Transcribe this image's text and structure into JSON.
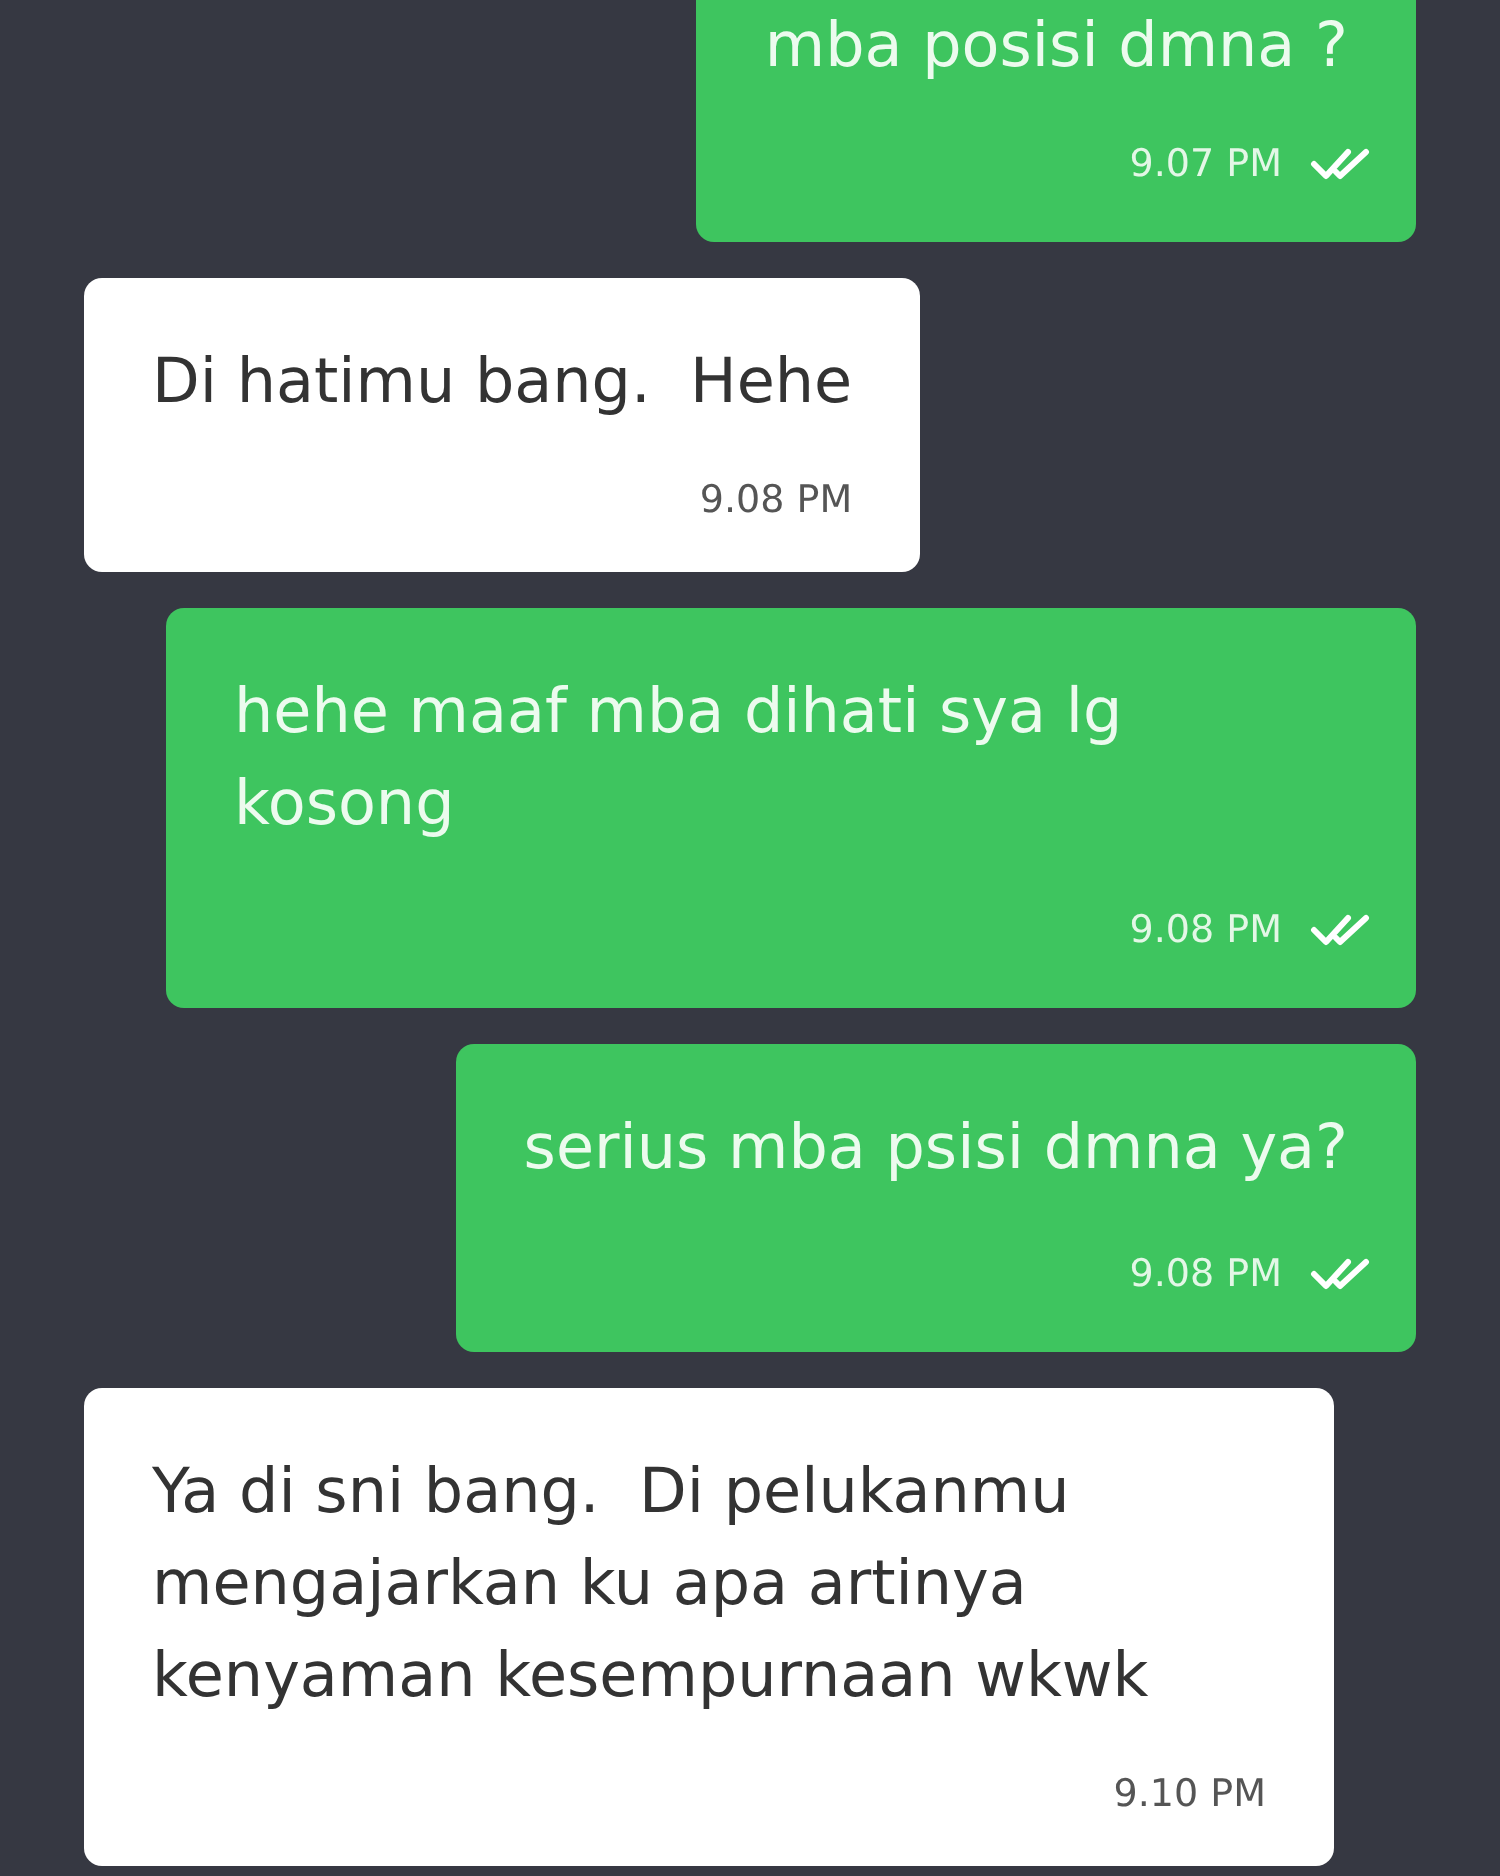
{
  "messages": [
    {
      "kind": "outgoing",
      "text": "mba posisi dmna ?",
      "time": "9.07 PM",
      "read": true
    },
    {
      "kind": "incoming",
      "text": "Di hatimu bang.  Hehe",
      "time": "9.08 PM"
    },
    {
      "kind": "outgoing",
      "text": "hehe maaf mba dihati sya lg kosong",
      "time": "9.08 PM",
      "read": true
    },
    {
      "kind": "outgoing",
      "text": "serius mba psisi dmna ya?",
      "time": "9.08 PM",
      "read": true
    },
    {
      "kind": "incoming",
      "text": "Ya di sni bang.  Di pelukanmu mengajarkan ku apa artinya kenyaman kesempurnaan wkwk",
      "time": "9.10 PM"
    }
  ]
}
